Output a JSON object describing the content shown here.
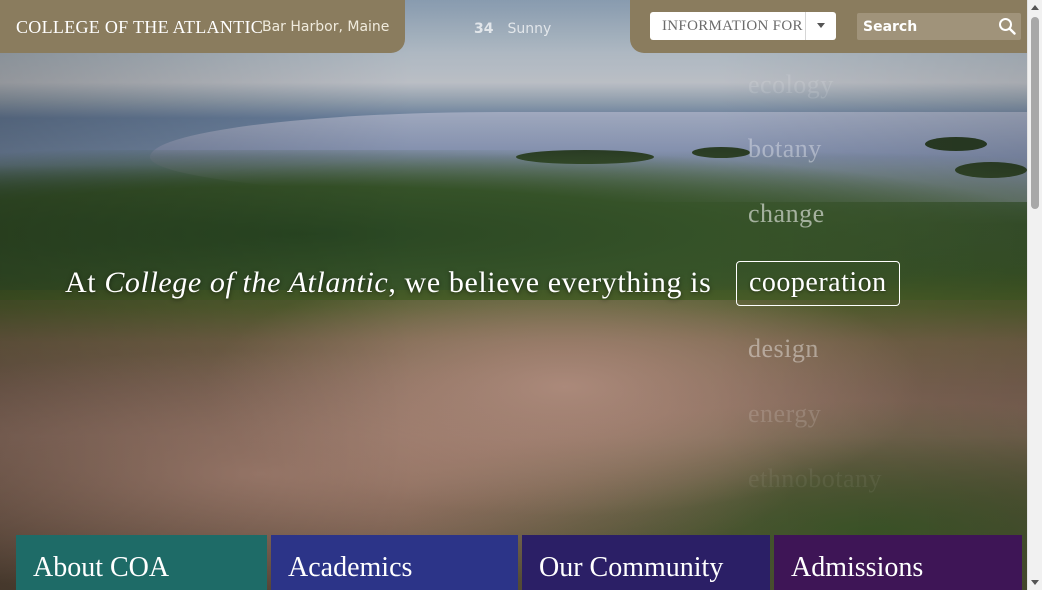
{
  "header": {
    "site_title": "COLLEGE OF THE ATLANTIC",
    "location": "Bar Harbor, Maine",
    "weather": {
      "temperature": "34",
      "condition": "Sunny"
    },
    "info_select": {
      "label": "INFORMATION FOR",
      "icon": "chevron-down-icon"
    },
    "search": {
      "placeholder": "Search",
      "value": "",
      "icon": "search-icon"
    }
  },
  "hero": {
    "belief_prefix": "At ",
    "belief_college": "College of the Atlantic",
    "belief_suffix": ", we believe everything is",
    "words": [
      "ecology",
      "botany",
      "change",
      "cooperation",
      "design",
      "energy",
      "ethnobotany"
    ],
    "active_word": "cooperation"
  },
  "nav_tiles": [
    {
      "label": "About COA",
      "color": "#1e6b67"
    },
    {
      "label": "Academics",
      "color": "#2c3488"
    },
    {
      "label": "Our Community",
      "color": "#2b1f66"
    },
    {
      "label": "Admissions",
      "color": "#3e1556"
    }
  ],
  "colors": {
    "header_bar": "#8a7c5e",
    "search_bg": "#a0937a"
  }
}
